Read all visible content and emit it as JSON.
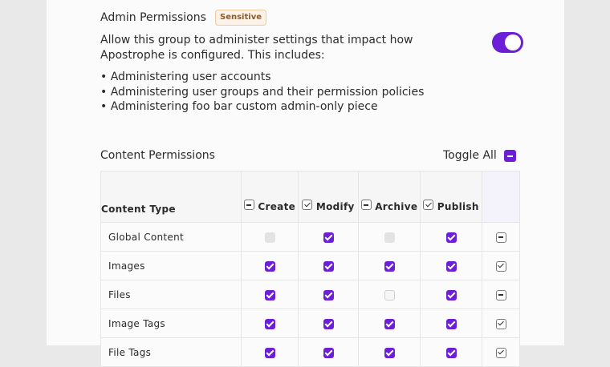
{
  "admin": {
    "title": "Admin Permissions",
    "badge": "Sensitive",
    "description": "Allow this group to administer settings that impact how Apostrophe is configured. This includes:",
    "bullets": [
      "Administering user accounts",
      "Administering user groups and their permission policies",
      "Administering foo bar custom admin-only piece"
    ],
    "enabled": true
  },
  "content": {
    "title": "Content Permissions",
    "toggle_all_label": "Toggle All",
    "columns": {
      "type": "Content Type",
      "create": "Create",
      "modify": "Modify",
      "archive": "Archive",
      "publish": "Publish"
    },
    "rows": [
      {
        "label": "Global Content",
        "create": "off",
        "modify": "on",
        "archive": "off",
        "publish": "on",
        "all": "dash"
      },
      {
        "label": "Images",
        "create": "on",
        "modify": "on",
        "archive": "on",
        "publish": "on",
        "all": "check"
      },
      {
        "label": "Files",
        "create": "on",
        "modify": "on",
        "archive": "empty",
        "publish": "on",
        "all": "dash"
      },
      {
        "label": "Image Tags",
        "create": "on",
        "modify": "on",
        "archive": "on",
        "publish": "on",
        "all": "check"
      },
      {
        "label": "File Tags",
        "create": "on",
        "modify": "on",
        "archive": "on",
        "publish": "on",
        "all": "check"
      }
    ]
  },
  "colors": {
    "accent": "#6c1fd6",
    "badge_text": "#8a5a2c",
    "badge_bg": "#fdf2e6"
  }
}
